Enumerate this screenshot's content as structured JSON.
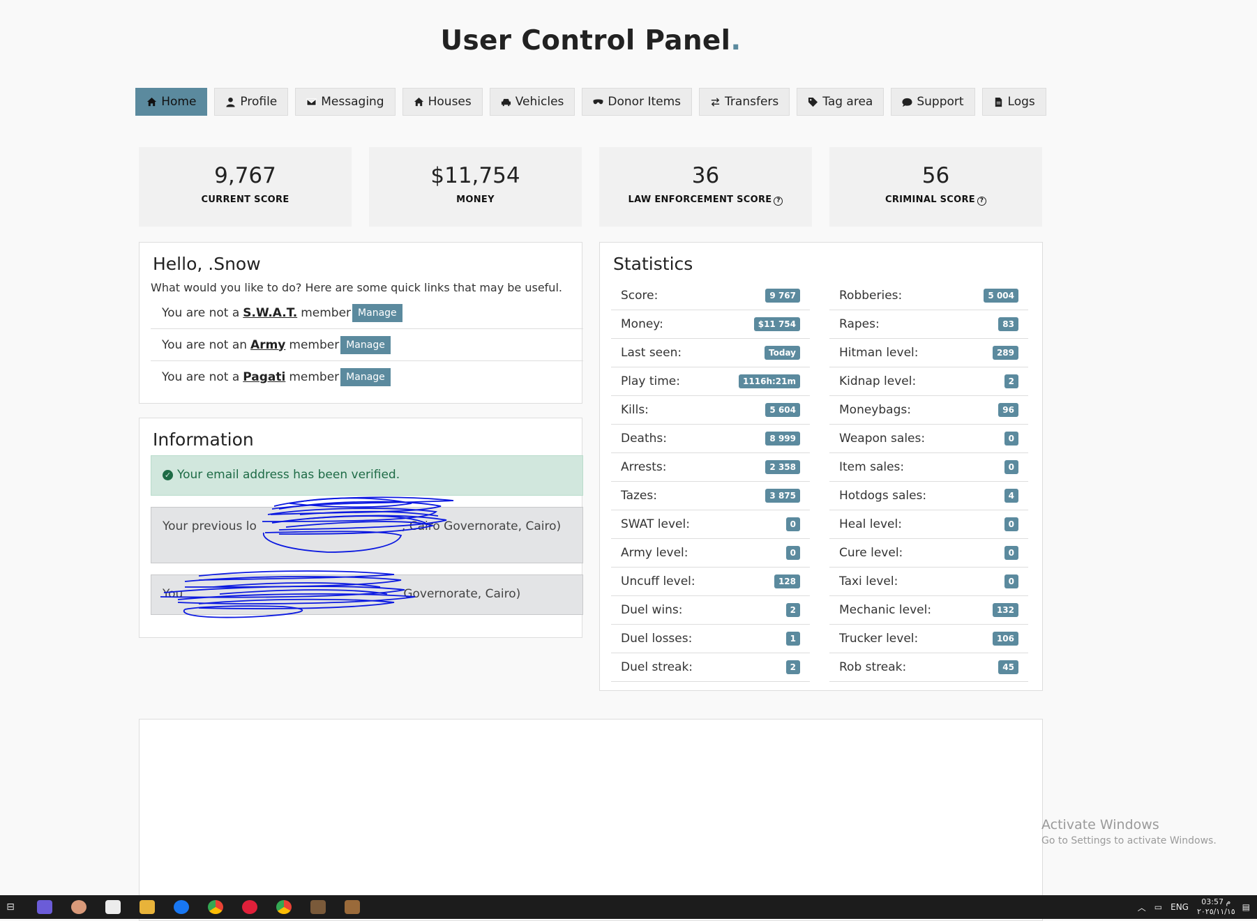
{
  "header": {
    "title": "User Control Panel",
    "title_dot": "."
  },
  "nav": [
    {
      "label": "Home",
      "icon": "home-icon",
      "active": true
    },
    {
      "label": "Profile",
      "icon": "user-icon",
      "active": false
    },
    {
      "label": "Messaging",
      "icon": "envelope-icon",
      "active": false
    },
    {
      "label": "Houses",
      "icon": "home-icon",
      "active": false
    },
    {
      "label": "Vehicles",
      "icon": "car-icon",
      "active": false
    },
    {
      "label": "Donor Items",
      "icon": "mask-icon",
      "active": false
    },
    {
      "label": "Transfers",
      "icon": "transfer-arrows-icon",
      "active": false
    },
    {
      "label": "Tag area",
      "icon": "tag-icon",
      "active": false
    },
    {
      "label": "Support",
      "icon": "chat-bubble-icon",
      "active": false
    },
    {
      "label": "Logs",
      "icon": "document-icon",
      "active": false
    }
  ],
  "summary": [
    {
      "value": "9,767",
      "label": "CURRENT SCORE",
      "help": false
    },
    {
      "value": "$11,754",
      "label": "MONEY",
      "help": false
    },
    {
      "value": "36",
      "label": "LAW ENFORCEMENT SCORE",
      "help": true
    },
    {
      "value": "56",
      "label": "CRIMINAL SCORE",
      "help": true
    }
  ],
  "greeting": {
    "title": "Hello, .Snow",
    "intro": "What would you like to do? Here are some quick links that may be useful.",
    "memberships": [
      {
        "prefix": "You are not a",
        "group": "S.W.A.T.",
        "suffix": "member",
        "button": "Manage"
      },
      {
        "prefix": "You are not an",
        "group": "Army",
        "suffix": "member",
        "button": "Manage"
      },
      {
        "prefix": "You are not a",
        "group": "Pagati",
        "suffix": "member",
        "button": "Manage"
      }
    ]
  },
  "information": {
    "title": "Information",
    "verified": "Your email address has been verified.",
    "previous_login_visible": "Your previous lo",
    "previous_login_tail": ", Cairo Governorate, Cairo)",
    "current_login_visible": "You",
    "current_login_tail": "Governorate, Cairo)"
  },
  "statistics": {
    "title": "Statistics",
    "left": [
      {
        "label": "Score:",
        "value": "9 767"
      },
      {
        "label": "Money:",
        "value": "$11 754"
      },
      {
        "label": "Last seen:",
        "value": "Today"
      },
      {
        "label": "Play time:",
        "value": "1116h:21m"
      },
      {
        "label": "Kills:",
        "value": "5 604"
      },
      {
        "label": "Deaths:",
        "value": "8 999"
      },
      {
        "label": "Arrests:",
        "value": "2 358"
      },
      {
        "label": "Tazes:",
        "value": "3 875"
      },
      {
        "label": "SWAT level:",
        "value": "0"
      },
      {
        "label": "Army level:",
        "value": "0"
      },
      {
        "label": "Uncuff level:",
        "value": "128"
      },
      {
        "label": "Duel wins:",
        "value": "2"
      },
      {
        "label": "Duel losses:",
        "value": "1"
      },
      {
        "label": "Duel streak:",
        "value": "2"
      }
    ],
    "right": [
      {
        "label": "Robberies:",
        "value": "5 004"
      },
      {
        "label": "Rapes:",
        "value": "83"
      },
      {
        "label": "Hitman level:",
        "value": "289"
      },
      {
        "label": "Kidnap level:",
        "value": "2"
      },
      {
        "label": "Moneybags:",
        "value": "96"
      },
      {
        "label": "Weapon sales:",
        "value": "0"
      },
      {
        "label": "Item sales:",
        "value": "0"
      },
      {
        "label": "Hotdogs sales:",
        "value": "4"
      },
      {
        "label": "Heal level:",
        "value": "0"
      },
      {
        "label": "Cure level:",
        "value": "0"
      },
      {
        "label": "Taxi level:",
        "value": "0"
      },
      {
        "label": "Mechanic level:",
        "value": "132"
      },
      {
        "label": "Trucker level:",
        "value": "106"
      },
      {
        "label": "Rob streak:",
        "value": "45"
      }
    ]
  },
  "watermark": {
    "line1": "Activate Windows",
    "line2": "Go to Settings to activate Windows."
  },
  "taskbar": {
    "language": "ENG",
    "time": "03:57 م",
    "date": "٢٠٢٥/١١/١٥"
  },
  "colors": {
    "accent": "#5b8a9e",
    "success_bg": "#d1e7dd",
    "scribble": "#0a18e0"
  }
}
